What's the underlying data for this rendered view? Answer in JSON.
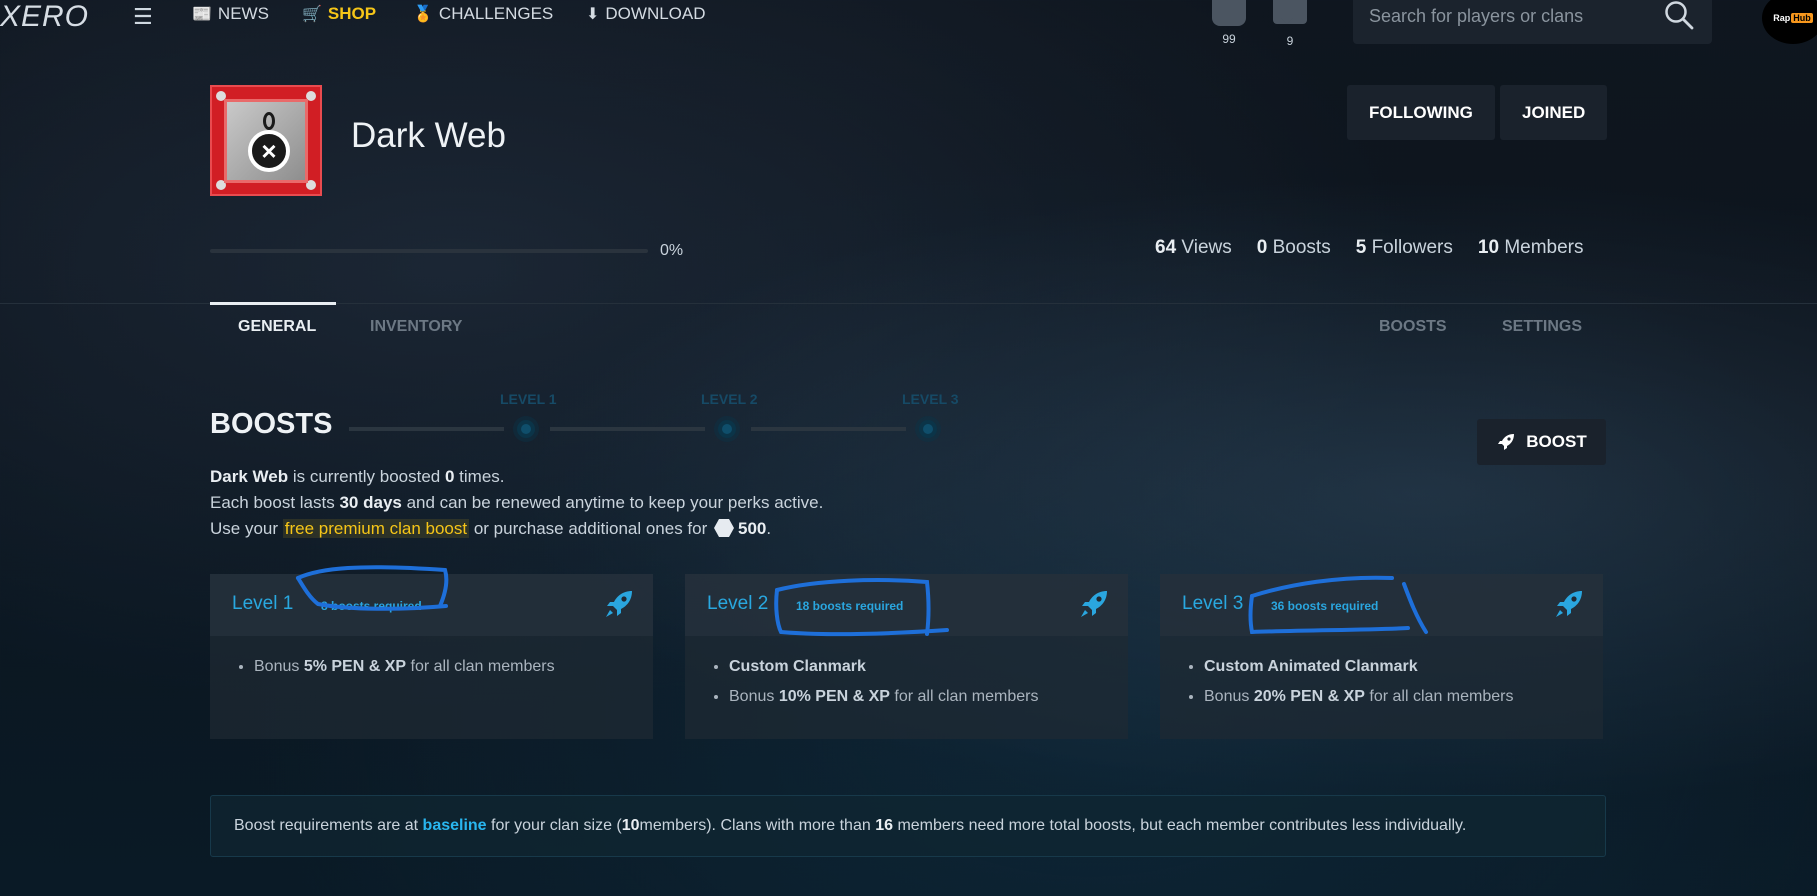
{
  "nav": {
    "logo": "XERO",
    "menu_icon": "hamburger-icon",
    "links": [
      {
        "label": "NEWS",
        "icon": "newspaper-icon"
      },
      {
        "label": "SHOP",
        "icon": "cart-icon",
        "color": "#f5c518"
      },
      {
        "label": "CHALLENGES",
        "icon": "medal-icon"
      },
      {
        "label": "DOWNLOAD",
        "icon": "download-icon"
      }
    ],
    "notifications_count": "99",
    "messages_count": "9",
    "search_placeholder": "Search for players or clans",
    "avatar_text": "Rap",
    "avatar_badge": "Hub"
  },
  "clan": {
    "name": "Dark Web",
    "emblem_icon": "x-circle-icon",
    "following_label": "FOLLOWING",
    "joined_label": "JOINED",
    "progress_percent": 0,
    "progress_label": "0%",
    "stats": [
      {
        "value": "64",
        "label": "Views"
      },
      {
        "value": "0",
        "label": "Boosts"
      },
      {
        "value": "5",
        "label": "Followers"
      },
      {
        "value": "10",
        "label": "Members"
      }
    ]
  },
  "tabs": {
    "general": "GENERAL",
    "inventory": "INVENTORY",
    "boosts": "BOOSTS",
    "settings": "SETTINGS",
    "active": "GENERAL"
  },
  "boosts": {
    "title": "BOOSTS",
    "levels_track": [
      "LEVEL 1",
      "LEVEL 2",
      "LEVEL 3"
    ],
    "boost_button": "BOOST",
    "line1": {
      "clan": "Dark Web",
      "a": " is currently boosted ",
      "count": "0",
      "b": " times."
    },
    "line2": {
      "a": "Each boost lasts ",
      "days": "30 days",
      "b": " and can be renewed anytime to keep your perks active."
    },
    "line3": {
      "a": "Use your ",
      "promo": "free premium clan boost",
      "b": " or purchase additional ones for ",
      "price": "500",
      "c": "."
    },
    "cards": [
      {
        "name": "Level 1",
        "required": "8 boosts required",
        "perks": [
          {
            "pre": "Bonus ",
            "bold": "5% PEN & XP",
            "post": " for all clan members"
          }
        ]
      },
      {
        "name": "Level 2",
        "required": "18 boosts required",
        "perks": [
          {
            "pre": "",
            "bold": "Custom Clanmark",
            "post": ""
          },
          {
            "pre": "Bonus ",
            "bold": "10% PEN & XP",
            "post": " for all clan members"
          }
        ]
      },
      {
        "name": "Level 3",
        "required": "36 boosts required",
        "perks": [
          {
            "pre": "",
            "bold": "Custom Animated Clanmark",
            "post": ""
          },
          {
            "pre": "Bonus ",
            "bold": "20% PEN & XP",
            "post": " for all clan members"
          }
        ]
      }
    ],
    "notice": {
      "a": "Boost requirements are at ",
      "hl": "baseline",
      "b": " for your clan size (",
      "size": "10",
      "c": " members). Clans with more than ",
      "threshold": "16",
      "d": " members need more total boosts, but each member contributes less individually."
    }
  },
  "colors": {
    "accent": "#29a8e0",
    "shop": "#f5c518",
    "annotation": "#1e6fd9"
  }
}
